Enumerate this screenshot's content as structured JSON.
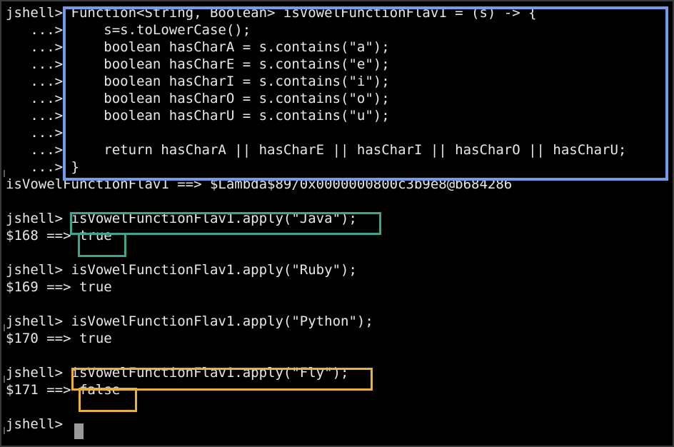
{
  "terminal": {
    "lines": [
      {
        "prompt": "jshell>",
        "text": " Function<String, Boolean> isVowelFunctionFlav1 = (s) -> {"
      },
      {
        "prompt": "   ...>",
        "text": "     s=s.toLowerCase();"
      },
      {
        "prompt": "   ...>",
        "text": "     boolean hasCharA = s.contains(\"a\");"
      },
      {
        "prompt": "   ...>",
        "text": "     boolean hasCharE = s.contains(\"e\");"
      },
      {
        "prompt": "   ...>",
        "text": "     boolean hasCharI = s.contains(\"i\");"
      },
      {
        "prompt": "   ...>",
        "text": "     boolean hasCharO = s.contains(\"o\");"
      },
      {
        "prompt": "   ...>",
        "text": "     boolean hasCharU = s.contains(\"u\");"
      },
      {
        "prompt": "   ...>",
        "text": ""
      },
      {
        "prompt": "   ...>",
        "text": "     return hasCharA || hasCharE || hasCharI || hasCharO || hasCharU;"
      },
      {
        "prompt": "   ...>",
        "text": " }"
      },
      {
        "prompt": "",
        "text": "isVowelFunctionFlav1 ==> $Lambda$89/0x0000000800c3b9e8@b684286"
      },
      {
        "prompt": "",
        "text": ""
      },
      {
        "prompt": "jshell>",
        "text": " isVowelFunctionFlav1.apply(\"Java\");"
      },
      {
        "prompt": "",
        "text": "$168 ==> true"
      },
      {
        "prompt": "",
        "text": ""
      },
      {
        "prompt": "jshell>",
        "text": " isVowelFunctionFlav1.apply(\"Ruby\");"
      },
      {
        "prompt": "",
        "text": "$169 ==> true"
      },
      {
        "prompt": "",
        "text": ""
      },
      {
        "prompt": "jshell>",
        "text": " isVowelFunctionFlav1.apply(\"Python\");"
      },
      {
        "prompt": "",
        "text": "$170 ==> true"
      },
      {
        "prompt": "",
        "text": ""
      },
      {
        "prompt": "jshell>",
        "text": " isVowelFunctionFlav1.apply(\"Fly\");"
      },
      {
        "prompt": "",
        "text": "$171 ==> false"
      },
      {
        "prompt": "",
        "text": ""
      },
      {
        "prompt": "jshell>",
        "text": " "
      }
    ]
  },
  "highlights": {
    "function_block_color": "#6f9ee6",
    "java_call_color": "#3fa48c",
    "fly_call_color": "#e8b13c"
  }
}
